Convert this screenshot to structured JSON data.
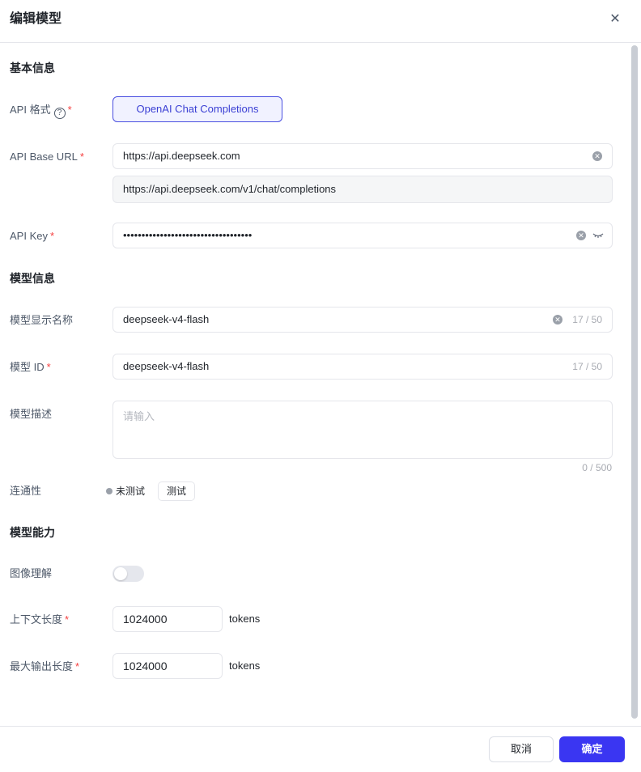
{
  "dialog": {
    "title": "编辑模型",
    "close_icon": "close-icon"
  },
  "basic": {
    "heading": "基本信息",
    "api_format_label": "API 格式",
    "api_format_value": "OpenAI Chat Completions",
    "base_url_label": "API Base URL",
    "base_url_value": "https://api.deepseek.com",
    "base_url_preview": "https://api.deepseek.com/v1/chat/completions",
    "api_key_label": "API Key",
    "api_key_value": "•••••••••••••••••••••••••••••••••••"
  },
  "model": {
    "heading": "模型信息",
    "display_name_label": "模型显示名称",
    "display_name_value": "deepseek-v4-flash",
    "display_name_count": "17 / 50",
    "id_label": "模型 ID",
    "id_value": "deepseek-v4-flash",
    "id_count": "17 / 50",
    "desc_label": "模型描述",
    "desc_placeholder": "请输入",
    "desc_count": "0 / 500",
    "connectivity_label": "连通性",
    "connectivity_status": "未测试",
    "test_button": "测试"
  },
  "capability": {
    "heading": "模型能力",
    "image_label": "图像理解",
    "image_enabled": false,
    "context_label": "上下文长度",
    "context_value": "1024000",
    "context_unit": "tokens",
    "max_output_label": "最大输出长度",
    "max_output_value": "1024000",
    "max_output_unit": "tokens"
  },
  "footer": {
    "cancel": "取消",
    "confirm": "确定"
  },
  "colors": {
    "primary": "#3a36f2",
    "required": "#f53f3f"
  }
}
